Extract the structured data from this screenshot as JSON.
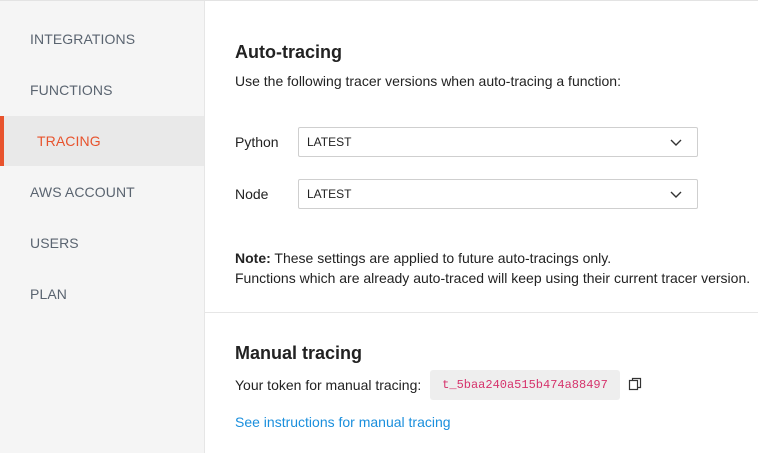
{
  "sidebar": {
    "items": [
      {
        "label": "INTEGRATIONS",
        "active": false
      },
      {
        "label": "FUNCTIONS",
        "active": false
      },
      {
        "label": "TRACING",
        "active": true
      },
      {
        "label": "AWS ACCOUNT",
        "active": false
      },
      {
        "label": "USERS",
        "active": false
      },
      {
        "label": "PLAN",
        "active": false
      }
    ]
  },
  "auto_tracing": {
    "title": "Auto-tracing",
    "description": "Use the following tracer versions when auto-tracing a function:",
    "python": {
      "label": "Python",
      "value": "LATEST"
    },
    "node": {
      "label": "Node",
      "value": "LATEST"
    },
    "note_label": "Note:",
    "note_line1": " These settings are applied to future auto-tracings only.",
    "note_line2": "Functions which are already auto-traced will keep using their current tracer version."
  },
  "manual_tracing": {
    "title": "Manual tracing",
    "token_label": "Your token for manual tracing:",
    "token": "t_5baa240a515b474a88497",
    "copy_icon": "copy-icon",
    "instructions_link": "See instructions for manual tracing"
  },
  "colors": {
    "accent": "#e8532d",
    "link": "#1a8fdd",
    "token": "#d6336c"
  }
}
